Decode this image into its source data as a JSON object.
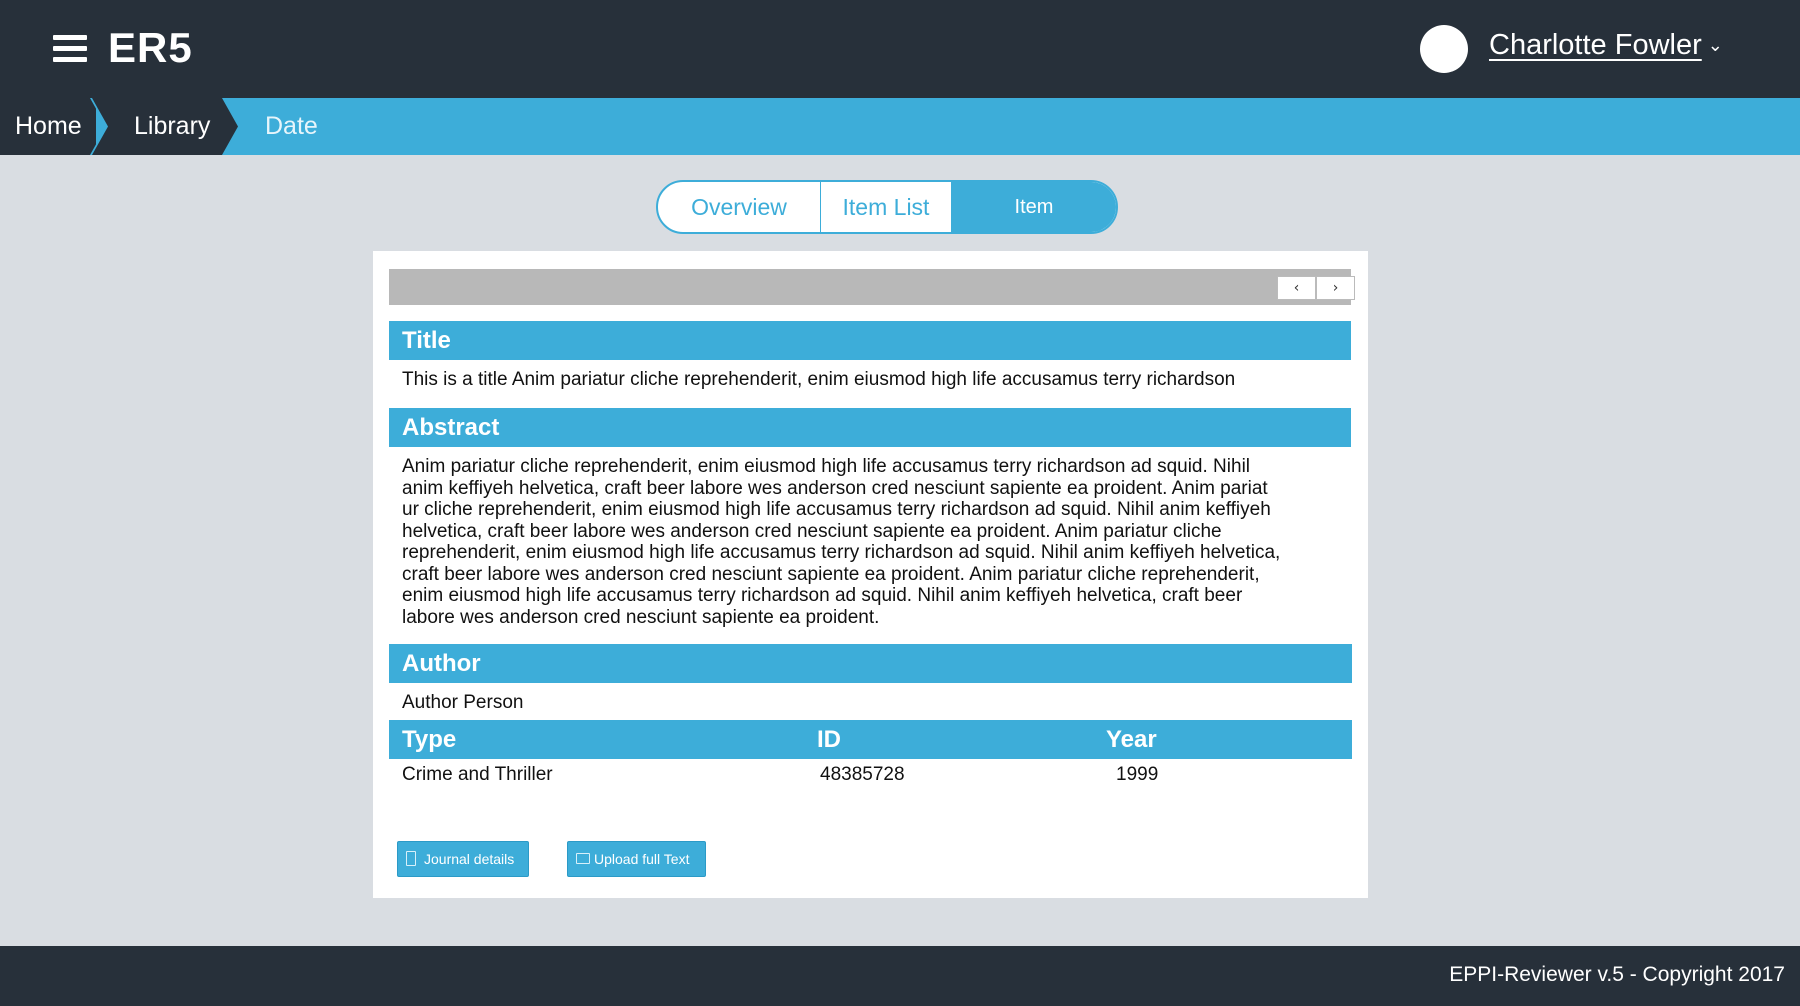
{
  "app": {
    "brand": "ER5"
  },
  "user": {
    "name": "Charlotte Fowler",
    "chevron": "⌄"
  },
  "breadcrumb": {
    "items": [
      "Home",
      "Library",
      "Date"
    ]
  },
  "tabs": [
    {
      "label": "Overview",
      "active": false
    },
    {
      "label": "Item List",
      "active": false
    },
    {
      "label": "Item",
      "active": true
    }
  ],
  "toolbar": {
    "prev": "‹",
    "next": "›"
  },
  "item": {
    "title_heading": "Title",
    "title": "This is a title Anim pariatur cliche reprehenderit, enim eiusmod high life accusamus terry richardson",
    "abstract_heading": "Abstract",
    "abstract_lines": [
      "Anim pariatur cliche reprehenderit, enim eiusmod high life accusamus terry richardson ad squid. Nihil",
      "anim keffiyeh helvetica, craft beer labore wes anderson cred nesciunt sapiente ea proident. Anim pariat",
      "ur cliche reprehenderit, enim eiusmod high life accusamus terry richardson ad squid. Nihil anim keffiyeh",
      "helvetica, craft beer labore wes anderson cred nesciunt sapiente ea proident. Anim pariatur cliche",
      "reprehenderit, enim eiusmod high life accusamus terry richardson ad squid. Nihil anim keffiyeh helvetica,",
      "craft beer labore wes anderson cred nesciunt sapiente ea proident. Anim pariatur cliche reprehenderit,",
      "enim eiusmod high life accusamus terry richardson ad squid. Nihil anim keffiyeh helvetica, craft beer",
      "labore wes anderson cred nesciunt sapiente ea proident."
    ],
    "author_heading": "Author",
    "author": "Author Person",
    "meta_headers": {
      "type": "Type",
      "id": "ID",
      "year": "Year"
    },
    "meta_values": {
      "type": "Crime and Thriller",
      "id": "48385728",
      "year": "1999"
    }
  },
  "actions": {
    "journal": "Journal details",
    "upload": "Upload full Text"
  },
  "footer": {
    "text": "EPPI-Reviewer v.5 - Copyright 2017"
  },
  "colors": {
    "header": "#27303a",
    "accent": "#3dadd9",
    "background": "#d9dde2",
    "toolbar": "#b8b8b8"
  }
}
